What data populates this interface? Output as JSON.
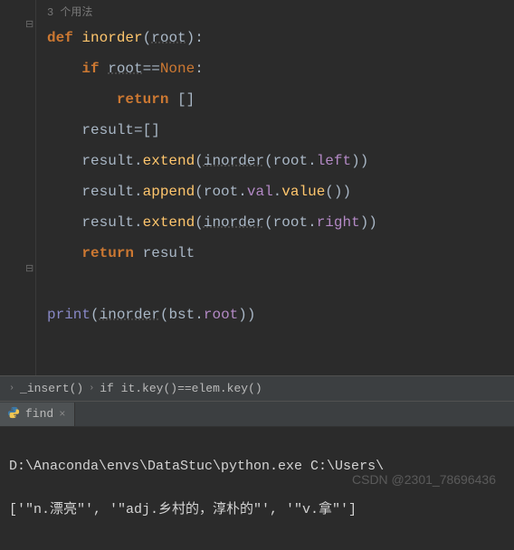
{
  "editor": {
    "usage_hint": "3 个用法",
    "lines": [
      "def inorder(root):",
      "    if root==None:",
      "        return []",
      "    result=[]",
      "    result.extend(inorder(root.left))",
      "    result.append(root.val.value())",
      "    result.extend(inorder(root.right))",
      "    return result",
      "",
      "print(inorder(bst.root))"
    ],
    "fold_markers": [
      "⊟",
      "⊟"
    ]
  },
  "breadcrumb": {
    "items": [
      "_insert()",
      "if it.key()==elem.key()"
    ]
  },
  "tab": {
    "label": "find",
    "close": "×"
  },
  "console": {
    "line1": "D:\\Anaconda\\envs\\DataStuc\\python.exe C:\\Users\\",
    "line2": "['\"n.漂亮\"', '\"adj.乡村的，淳朴的\"', '\"v.拿\"']"
  },
  "watermark": "CSDN @2301_78696436"
}
